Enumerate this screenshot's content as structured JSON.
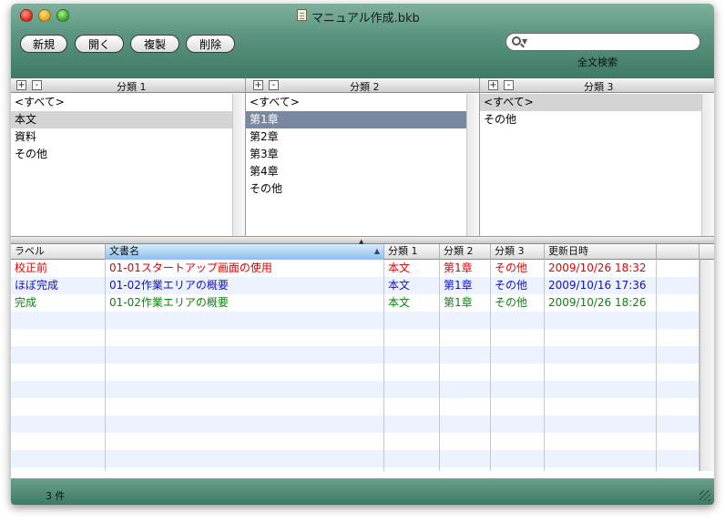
{
  "window": {
    "title": "マニュアル作成.bkb"
  },
  "toolbar": {
    "buttons": [
      "新規",
      "開く",
      "複製",
      "削除"
    ],
    "search": {
      "value": "",
      "placeholder": "",
      "label": "全文検索"
    }
  },
  "categories": [
    {
      "title": "分類 1",
      "plus": "+",
      "minus": "-",
      "items": [
        "<すべて>",
        "本文",
        "資料",
        "その他"
      ],
      "selected": 1,
      "selected_style": "gray"
    },
    {
      "title": "分類 2",
      "plus": "+",
      "minus": "-",
      "items": [
        "<すべて>",
        "第1章",
        "第2章",
        "第3章",
        "第4章",
        "その他"
      ],
      "selected": 1,
      "selected_style": "blue"
    },
    {
      "title": "分類 3",
      "plus": "+",
      "minus": "-",
      "items": [
        "<すべて>",
        "その他"
      ],
      "selected": 0,
      "selected_style": "gray"
    }
  ],
  "table": {
    "columns": [
      "ラベル",
      "文書名",
      "分類 1",
      "分類 2",
      "分類 3",
      "更新日時",
      ""
    ],
    "sorted_column": 1,
    "sort_arrow": "▲",
    "rows": [
      {
        "label": "校正前",
        "name": "01-01スタートアップ画面の使用",
        "cat1": "本文",
        "cat2": "第1章",
        "cat3": "その他",
        "updated": "2009/10/26 18:32",
        "color": "#e00000"
      },
      {
        "label": "ほぼ完成",
        "name": "01-02作業エリアの概要",
        "cat1": "本文",
        "cat2": "第1章",
        "cat3": "その他",
        "updated": "2009/10/16 17:36",
        "color": "#1010c8"
      },
      {
        "label": "完成",
        "name": "01-02作業エリアの概要",
        "cat1": "本文",
        "cat2": "第1章",
        "cat3": "その他",
        "updated": "2009/10/26 18:26",
        "color": "#108010"
      }
    ]
  },
  "status": {
    "count_text": "3 件"
  },
  "colors": {
    "chrome": "#4a8670",
    "row_stripe": "#edf3fe",
    "selection_blue": "#7888a0",
    "selection_gray": "#d4d4d4"
  }
}
